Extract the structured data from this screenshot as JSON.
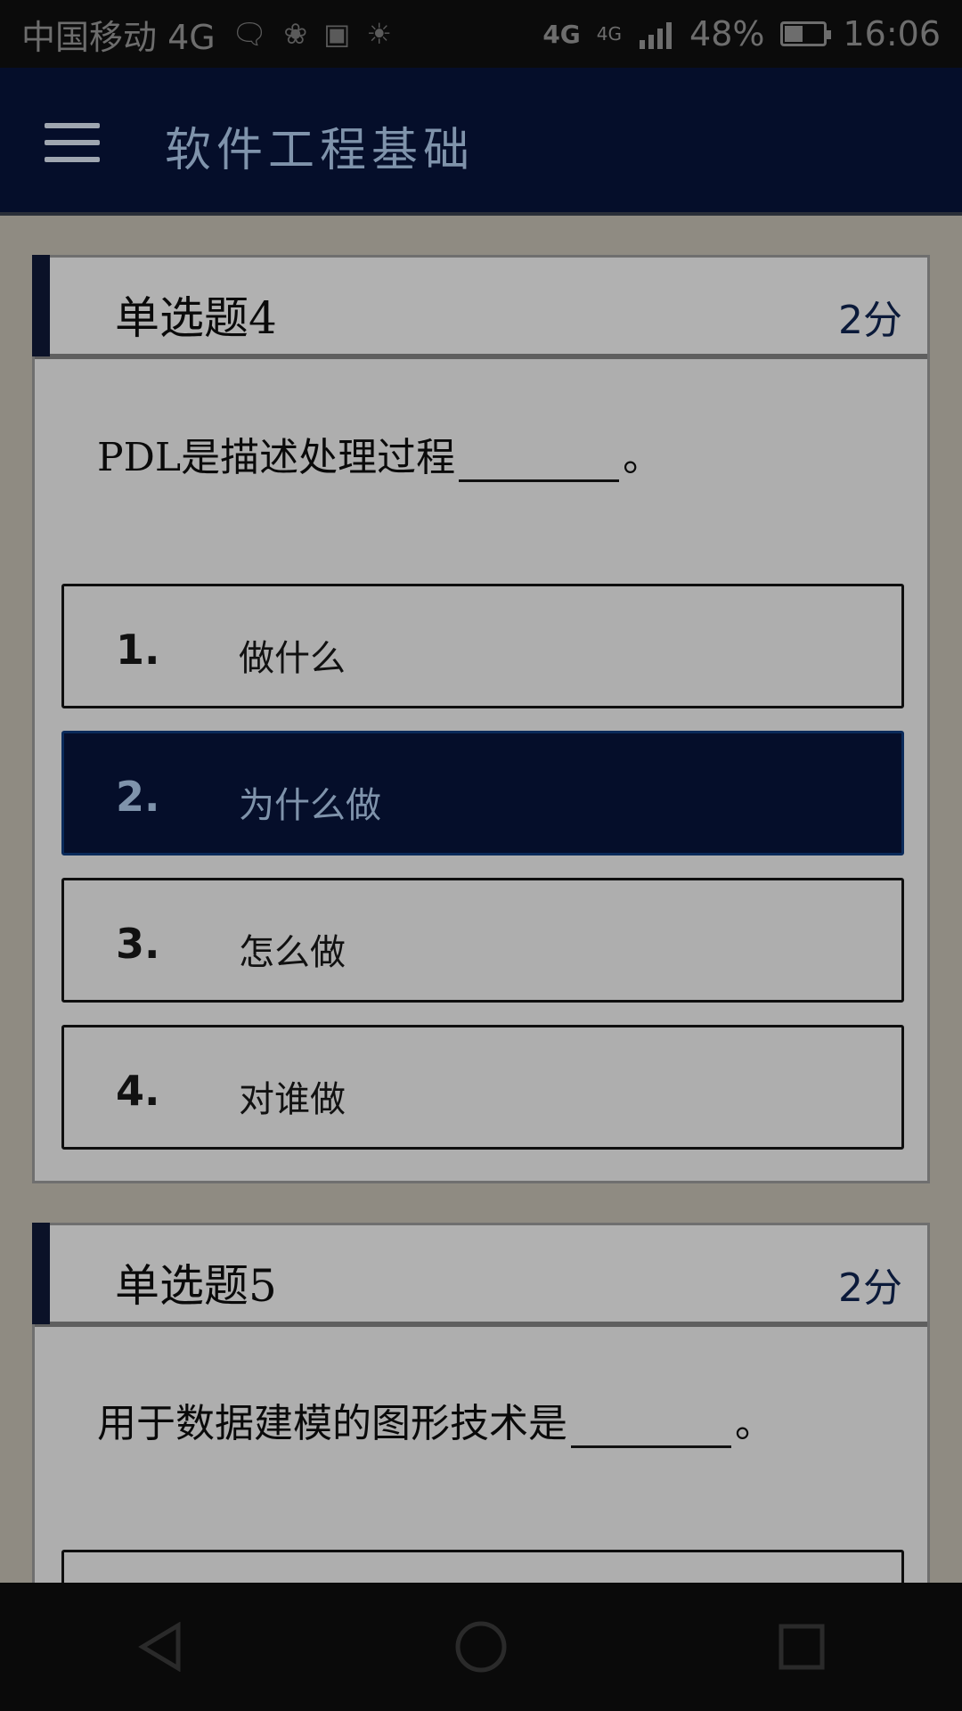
{
  "status_bar": {
    "carrier": "中国移动 4G",
    "network_left": "4G",
    "network_right": "4G",
    "battery_percent": "48%",
    "battery_level": 0.48,
    "time": "16:06"
  },
  "app_bar": {
    "title": "软件工程基础"
  },
  "questions": [
    {
      "title": "单选题4",
      "score": "2分",
      "text_before": "PDL是描述处理过程",
      "text_after": "。",
      "options": [
        {
          "num": "1.",
          "text": "做什么"
        },
        {
          "num": "2.",
          "text": "为什么做"
        },
        {
          "num": "3.",
          "text": "怎么做"
        },
        {
          "num": "4.",
          "text": "对谁做"
        }
      ],
      "selected_option": 2
    },
    {
      "title": "单选题5",
      "score": "2分",
      "text_before": "用于数据建模的图形技术是",
      "text_after": "。"
    }
  ],
  "colors": {
    "app_bar": "#050e2a",
    "selected_option": "#050e2a",
    "card": "#aeaeae",
    "background": "#8f8b82"
  }
}
